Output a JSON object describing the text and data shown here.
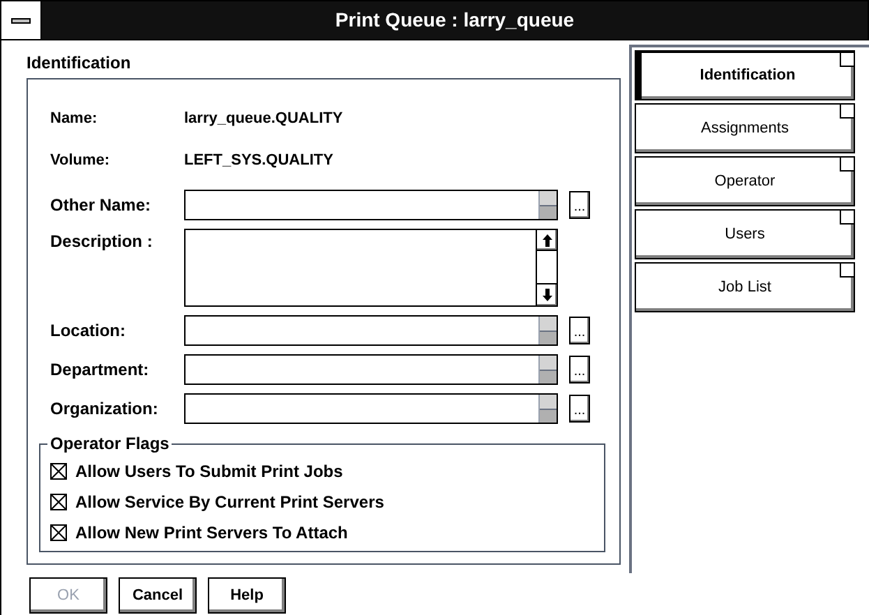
{
  "window": {
    "title": "Print Queue : larry_queue"
  },
  "section_title": "Identification",
  "info": [
    {
      "label": "Name:",
      "value": "larry_queue.QUALITY"
    },
    {
      "label": "Volume:",
      "value": "LEFT_SYS.QUALITY"
    }
  ],
  "fields": [
    {
      "label": "Other Name:",
      "kind": "line"
    },
    {
      "label": "Description :",
      "kind": "multiline"
    },
    {
      "label": "Location:",
      "kind": "line"
    },
    {
      "label": "Department:",
      "kind": "line"
    },
    {
      "label": "Organization:",
      "kind": "line"
    }
  ],
  "browse_label": "...",
  "operator_flags": {
    "title": "Operator Flags",
    "items": [
      {
        "label": "Allow Users To Submit Print Jobs",
        "checked": true
      },
      {
        "label": "Allow Service By Current Print Servers",
        "checked": true
      },
      {
        "label": "Allow New Print Servers To Attach",
        "checked": true
      }
    ]
  },
  "buttons": [
    {
      "label": "OK",
      "disabled": true
    },
    {
      "label": "Cancel",
      "disabled": false
    },
    {
      "label": "Help",
      "disabled": false
    }
  ],
  "tabs": [
    {
      "label": "Identification",
      "selected": true
    },
    {
      "label": "Assignments",
      "selected": false
    },
    {
      "label": "Operator",
      "selected": false
    },
    {
      "label": "Users",
      "selected": false
    },
    {
      "label": "Job List",
      "selected": false
    }
  ]
}
